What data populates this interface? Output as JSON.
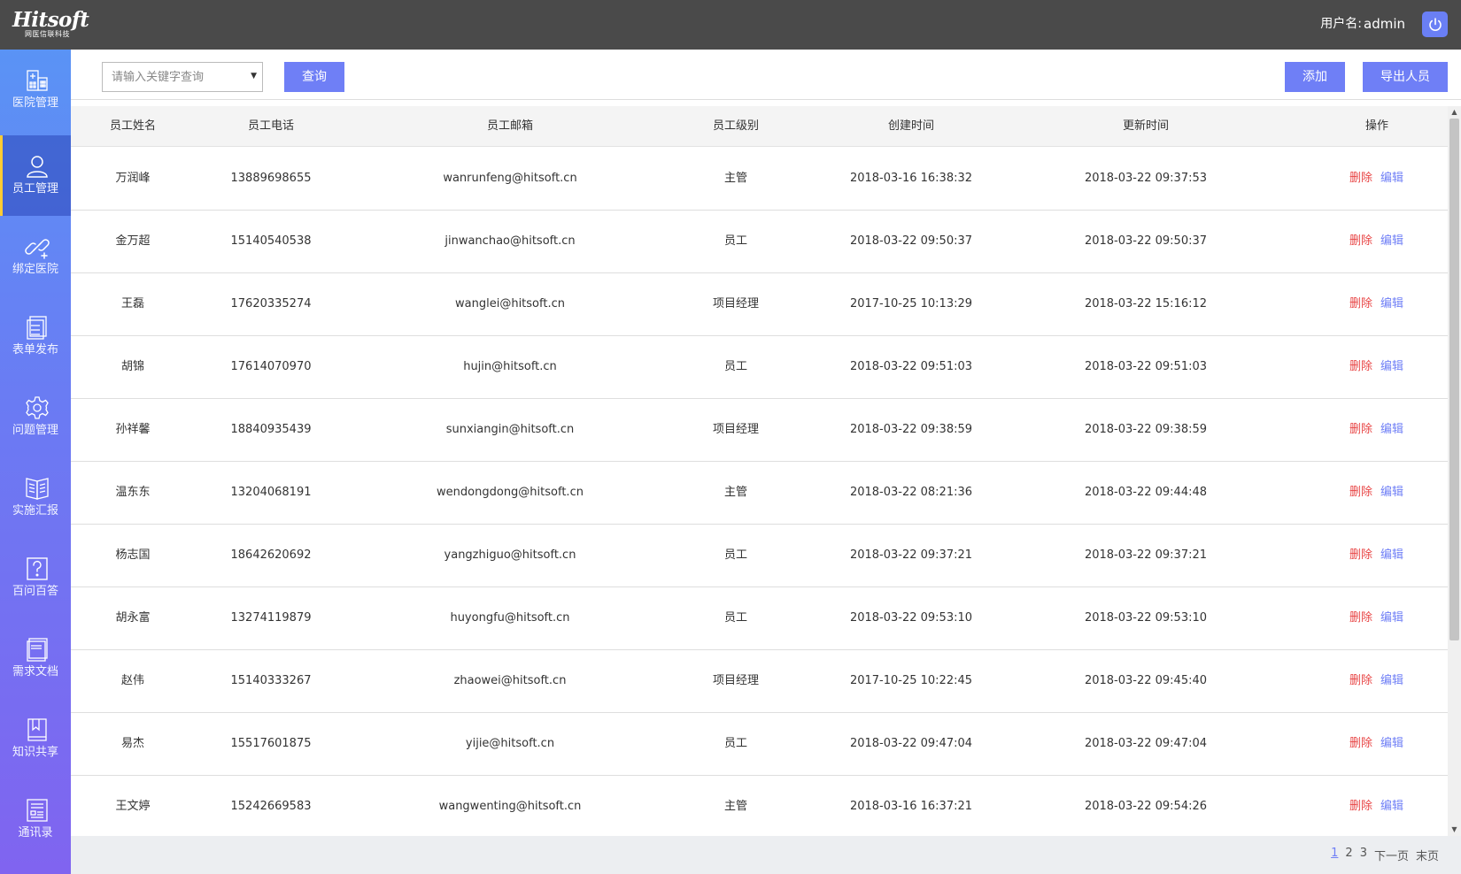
{
  "header": {
    "logo_text": "Hitsoft",
    "logo_subtext": "网医信联科技",
    "username_label": "用户名:",
    "username": "admin",
    "power_icon": "power-icon"
  },
  "sidebar": {
    "items": [
      {
        "label": "医院管理",
        "icon": "hospital-icon",
        "active": false
      },
      {
        "label": "员工管理",
        "icon": "person-icon",
        "active": true
      },
      {
        "label": "绑定医院",
        "icon": "link-icon",
        "active": false
      },
      {
        "label": "表单发布",
        "icon": "form-icon",
        "active": false
      },
      {
        "label": "问题管理",
        "icon": "gear-icon",
        "active": false
      },
      {
        "label": "实施汇报",
        "icon": "book-icon",
        "active": false
      },
      {
        "label": "百问百答",
        "icon": "question-icon",
        "active": false
      },
      {
        "label": "需求文档",
        "icon": "document-icon",
        "active": false
      },
      {
        "label": "知识共享",
        "icon": "bookmark-icon",
        "active": false
      },
      {
        "label": "通讯录",
        "icon": "contacts-icon",
        "active": false
      }
    ]
  },
  "toolbar": {
    "search_placeholder": "请输入关键字查询",
    "search_button": "查询",
    "add_button": "添加",
    "export_button": "导出人员"
  },
  "table": {
    "columns": [
      "员工姓名",
      "员工电话",
      "员工邮箱",
      "员工级别",
      "创建时间",
      "更新时间",
      "操作"
    ],
    "delete_label": "删除",
    "edit_label": "编辑",
    "rows": [
      {
        "name": "万润峰",
        "phone": "13889698655",
        "email": "wanrunfeng@hitsoft.cn",
        "level": "主管",
        "created": "2018-03-16 16:38:32",
        "updated": "2018-03-22 09:37:53"
      },
      {
        "name": "金万超",
        "phone": "15140540538",
        "email": "jinwanchao@hitsoft.cn",
        "level": "员工",
        "created": "2018-03-22 09:50:37",
        "updated": "2018-03-22 09:50:37"
      },
      {
        "name": "王磊",
        "phone": "17620335274",
        "email": "wanglei@hitsoft.cn",
        "level": "项目经理",
        "created": "2017-10-25 10:13:29",
        "updated": "2018-03-22 15:16:12"
      },
      {
        "name": "胡锦",
        "phone": "17614070970",
        "email": "hujin@hitsoft.cn",
        "level": "员工",
        "created": "2018-03-22 09:51:03",
        "updated": "2018-03-22 09:51:03"
      },
      {
        "name": "孙祥馨",
        "phone": "18840935439",
        "email": "sunxiangin@hitsoft.cn",
        "level": "项目经理",
        "created": "2018-03-22 09:38:59",
        "updated": "2018-03-22 09:38:59"
      },
      {
        "name": "温东东",
        "phone": "13204068191",
        "email": "wendongdong@hitsoft.cn",
        "level": "主管",
        "created": "2018-03-22 08:21:36",
        "updated": "2018-03-22 09:44:48"
      },
      {
        "name": "杨志国",
        "phone": "18642620692",
        "email": "yangzhiguo@hitsoft.cn",
        "level": "员工",
        "created": "2018-03-22 09:37:21",
        "updated": "2018-03-22 09:37:21"
      },
      {
        "name": "胡永富",
        "phone": "13274119879",
        "email": "huyongfu@hitsoft.cn",
        "level": "员工",
        "created": "2018-03-22 09:53:10",
        "updated": "2018-03-22 09:53:10"
      },
      {
        "name": "赵伟",
        "phone": "15140333267",
        "email": "zhaowei@hitsoft.cn",
        "level": "项目经理",
        "created": "2017-10-25 10:22:45",
        "updated": "2018-03-22 09:45:40"
      },
      {
        "name": "易杰",
        "phone": "15517601875",
        "email": "yijie@hitsoft.cn",
        "level": "员工",
        "created": "2018-03-22 09:47:04",
        "updated": "2018-03-22 09:47:04"
      },
      {
        "name": "王文婷",
        "phone": "15242669583",
        "email": "wangwenting@hitsoft.cn",
        "level": "主管",
        "created": "2018-03-16 16:37:21",
        "updated": "2018-03-22 09:54:26"
      }
    ]
  },
  "pagination": {
    "pages": [
      "1",
      "2",
      "3"
    ],
    "current": "1",
    "next_label": "下一页",
    "last_label": "末页"
  },
  "colors": {
    "accent": "#6f7ff6",
    "topbar": "#4a4a4a",
    "delete": "#e84545",
    "active_indicator": "#ffcc33"
  }
}
